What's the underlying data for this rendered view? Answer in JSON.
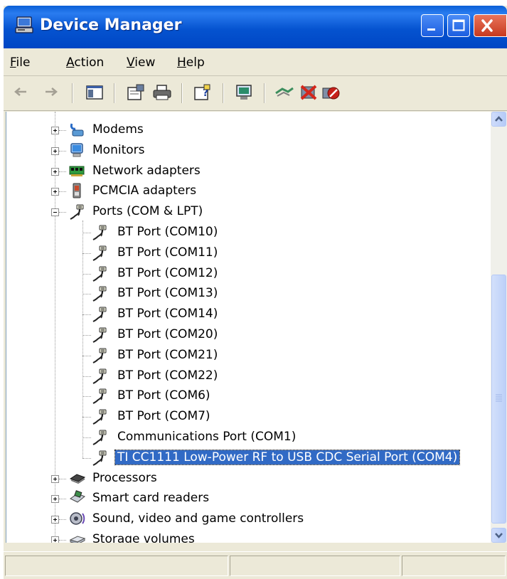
{
  "window": {
    "title": "Device Manager",
    "buttons": {
      "minimize": "minimize-icon",
      "maximize": "maximize-icon",
      "close": "close-icon"
    }
  },
  "menu": [
    {
      "pre": "",
      "key": "F",
      "post": "ile"
    },
    {
      "pre": "",
      "key": "A",
      "post": "ction"
    },
    {
      "pre": "",
      "key": "V",
      "post": "iew"
    },
    {
      "pre": "",
      "key": "H",
      "post": "elp"
    }
  ],
  "toolbar": [
    "back-arrow-icon",
    "forward-arrow-icon",
    "show-hide-console-tree-icon",
    "properties-icon",
    "print-icon",
    "help-icon",
    "scan-hardware-icon",
    "update-driver-icon",
    "uninstall-icon",
    "disable-device-icon"
  ],
  "tree": [
    {
      "label": "Modems",
      "icon": "modem-icon",
      "expander": "plus"
    },
    {
      "label": "Monitors",
      "icon": "monitor-icon",
      "expander": "plus"
    },
    {
      "label": "Network adapters",
      "icon": "network-adapter-icon",
      "expander": "plus"
    },
    {
      "label": "PCMCIA adapters",
      "icon": "pcmcia-icon",
      "expander": "plus"
    },
    {
      "label": "Ports (COM & LPT)",
      "icon": "port-icon",
      "expander": "minus"
    },
    {
      "label": "BT Port (COM10)",
      "icon": "port-icon",
      "child": true
    },
    {
      "label": "BT Port (COM11)",
      "icon": "port-icon",
      "child": true
    },
    {
      "label": "BT Port (COM12)",
      "icon": "port-icon",
      "child": true
    },
    {
      "label": "BT Port (COM13)",
      "icon": "port-icon",
      "child": true
    },
    {
      "label": "BT Port (COM14)",
      "icon": "port-icon",
      "child": true
    },
    {
      "label": "BT Port (COM20)",
      "icon": "port-icon",
      "child": true
    },
    {
      "label": "BT Port (COM21)",
      "icon": "port-icon",
      "child": true
    },
    {
      "label": "BT Port (COM22)",
      "icon": "port-icon",
      "child": true
    },
    {
      "label": "BT Port (COM6)",
      "icon": "port-icon",
      "child": true
    },
    {
      "label": "BT Port (COM7)",
      "icon": "port-icon",
      "child": true
    },
    {
      "label": "Communications Port (COM1)",
      "icon": "port-icon",
      "child": true
    },
    {
      "label": "TI CC1111 Low-Power RF to USB CDC Serial Port (COM4)",
      "icon": "port-icon",
      "child": true,
      "selected": true,
      "last": true
    },
    {
      "label": "Processors",
      "icon": "processor-icon",
      "expander": "plus"
    },
    {
      "label": "Smart card readers",
      "icon": "smart-card-reader-icon",
      "expander": "plus"
    },
    {
      "label": "Sound, video and game controllers",
      "icon": "sound-icon",
      "expander": "plus"
    },
    {
      "label": "Storage volumes",
      "icon": "storage-volume-icon",
      "expander": "plus"
    }
  ],
  "status": [
    "",
    "",
    ""
  ],
  "colors": {
    "titlebar": "#0553d0",
    "selection": "#316ac5",
    "chrome": "#ece9d8"
  }
}
